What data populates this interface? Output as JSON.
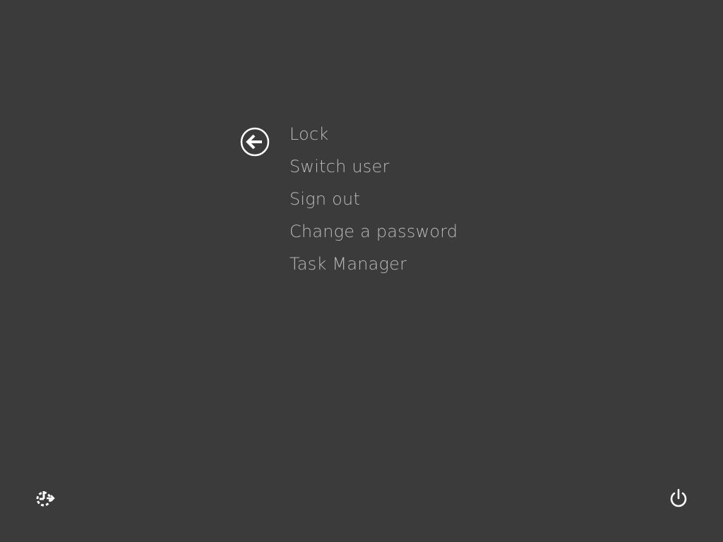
{
  "menu": {
    "items": [
      {
        "label": "Lock"
      },
      {
        "label": "Switch user"
      },
      {
        "label": "Sign out"
      },
      {
        "label": "Change a password"
      },
      {
        "label": "Task Manager"
      }
    ]
  },
  "icons": {
    "back": "back-arrow-circle-icon",
    "ease_of_access": "ease-of-access-icon",
    "power": "power-icon"
  },
  "colors": {
    "background": "#3b3b3b",
    "menu_text": "#b9b9b9",
    "icon": "#ffffff"
  }
}
